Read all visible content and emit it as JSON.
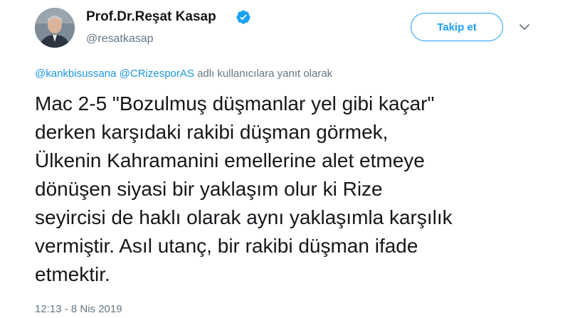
{
  "user": {
    "display_name": "Prof.Dr.Reşat Kasap",
    "handle": "@resatkasap",
    "verified": true
  },
  "actions": {
    "follow_label": "Takip et",
    "menu_icon": "chevron-down-icon"
  },
  "reply": {
    "mention_1": "@kankbisussana",
    "mention_2": "@CRizesporAS",
    "suffix": " adlı kullanıcılara yanıt olarak"
  },
  "tweet": {
    "lines": [
      "Mac 2-5 \"Bozulmuş düşmanlar yel gibi kaçar\"",
      "derken karşıdaki rakibi düşman görmek,",
      "Ülkenin Kahramanini emellerine alet etmeye",
      "dönüşen siyasi bir yaklaşım olur ki Rize",
      "seyircisi de haklı olarak aynı yaklaşımla karşılık",
      "vermiştir. Asıl utanç, bir rakibi düşman ifade",
      "etmektir."
    ],
    "timestamp": "12:13 - 8 Nis 2019"
  },
  "colors": {
    "accent": "#1da1f2",
    "secondary_text": "#657786",
    "primary_text": "#14171a"
  }
}
